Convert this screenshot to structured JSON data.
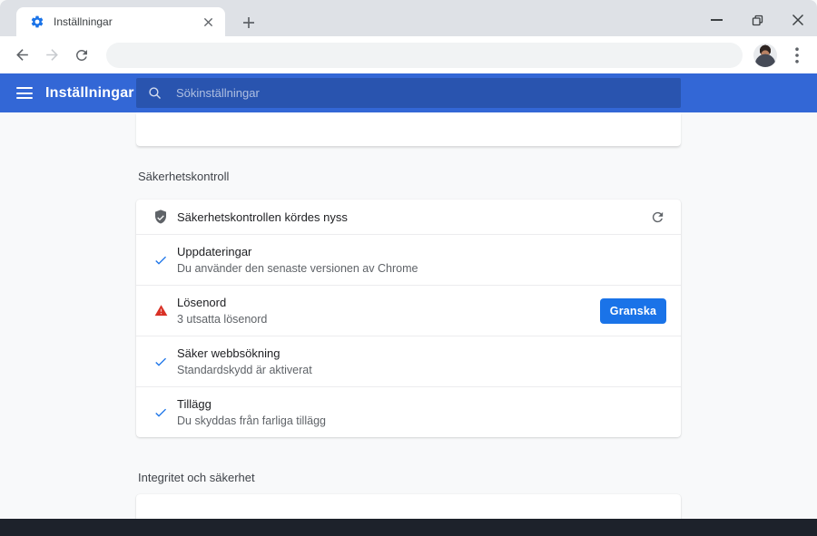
{
  "window": {
    "tab": {
      "title": "Inställningar"
    },
    "controls": {
      "minimize": "minimize",
      "restore": "restore",
      "close": "close"
    }
  },
  "settings_header": {
    "title": "Inställningar",
    "search_placeholder": "Sökinställningar"
  },
  "sections": {
    "safety_check_label": "Säkerhetskontroll",
    "privacy_label": "Integritet och säkerhet"
  },
  "safety_check": {
    "status": "Säkerhetskontrollen kördes nyss",
    "rows": [
      {
        "icon": "check-icon",
        "title": "Uppdateringar",
        "subtitle": "Du använder den senaste versionen av Chrome"
      },
      {
        "icon": "warning-icon",
        "title": "Lösenord",
        "subtitle": "3 utsatta lösenord",
        "button": "Granska"
      },
      {
        "icon": "check-icon",
        "title": "Säker webbsökning",
        "subtitle": "Standardskydd är aktiverat"
      },
      {
        "icon": "check-icon",
        "title": "Tillägg",
        "subtitle": "Du skyddas från farliga tillägg"
      }
    ]
  },
  "colors": {
    "accent_blue": "#1a73e8",
    "header_blue": "#3367d6",
    "warning_red": "#d93025",
    "tabstrip_grey": "#dee1e6",
    "page_background": "#f8f9fa",
    "shelf_dark": "#1d222b",
    "text_primary": "#202124",
    "text_secondary": "#5f6368"
  }
}
